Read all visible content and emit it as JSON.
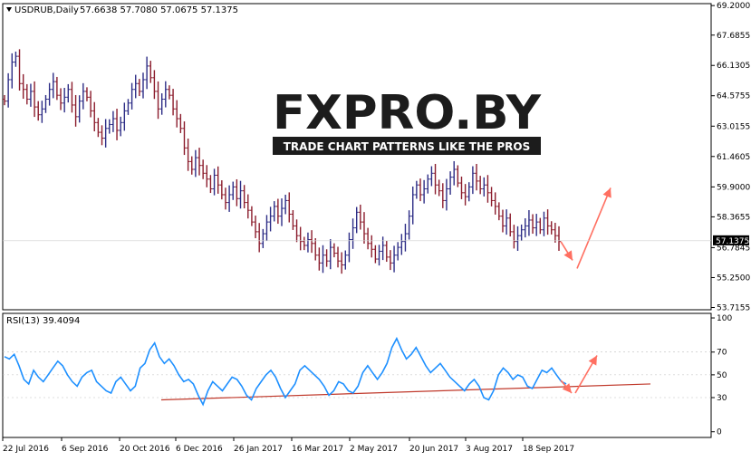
{
  "chart_data": [
    {
      "type": "ohlc",
      "header": {
        "symbol": "USDRUB,Daily",
        "ohlc_text": "57.6638 57.7080 57.0675 57.1375"
      },
      "x_tick_labels": [
        "22 Jul 2016",
        "6 Sep 2016",
        "20 Oct 2016",
        "6 Dec 2016",
        "26 Jan 2017",
        "16 Mar 2017",
        "2 May 2017",
        "20 Jun 2017",
        "3 Aug 2017",
        "18 Sep 2017"
      ],
      "y_ticks": [
        69.2,
        67.6855,
        66.1305,
        64.5755,
        63.0155,
        61.4605,
        59.9,
        58.3655,
        56.7845,
        55.25,
        53.7155
      ],
      "ylim": [
        53.6,
        69.3
      ],
      "current_price": 57.1375,
      "current_price_label": "57.1375",
      "close_series": [
        64.3,
        65.4,
        66.3,
        66.6,
        65.2,
        64.9,
        64.4,
        64.8,
        64.0,
        63.6,
        63.9,
        64.4,
        64.9,
        65.3,
        64.6,
        64.2,
        64.5,
        64.9,
        64.1,
        63.5,
        64.3,
        64.8,
        64.5,
        63.8,
        63.2,
        62.7,
        62.4,
        62.9,
        63.1,
        63.4,
        62.8,
        63.2,
        63.8,
        64.2,
        64.9,
        65.2,
        64.8,
        65.4,
        66.1,
        65.5,
        64.8,
        63.9,
        64.4,
        64.9,
        64.6,
        63.9,
        63.4,
        62.9,
        61.9,
        61.2,
        60.8,
        61.4,
        61.0,
        60.6,
        60.3,
        59.8,
        60.5,
        60.0,
        59.5,
        59.1,
        59.5,
        59.9,
        59.3,
        59.7,
        59.1,
        58.7,
        58.1,
        57.6,
        57.0,
        57.5,
        58.1,
        58.4,
        58.9,
        58.4,
        58.8,
        59.2,
        58.5,
        57.9,
        57.4,
        57.1,
        56.9,
        57.2,
        57.0,
        56.4,
        56.0,
        56.4,
        56.1,
        56.8,
        56.5,
        56.1,
        55.9,
        56.4,
        57.2,
        57.8,
        58.6,
        58.1,
        57.5,
        57.0,
        56.7,
        56.2,
        56.6,
        56.9,
        56.3,
        56.0,
        56.4,
        56.8,
        57.1,
        57.5,
        58.4,
        59.5,
        60.0,
        59.5,
        59.8,
        60.3,
        60.6,
        60.0,
        59.7,
        59.2,
        59.8,
        60.4,
        60.8,
        60.1,
        59.6,
        59.4,
        59.9,
        60.6,
        60.2,
        59.8,
        60.0,
        59.6,
        59.2,
        58.9,
        58.4,
        57.9,
        58.3,
        57.6,
        57.1,
        57.4,
        57.7,
        57.9,
        58.2,
        57.8,
        58.1,
        57.7,
        58.3,
        57.9,
        57.7,
        57.4,
        57.1
      ]
    },
    {
      "type": "line",
      "header": "RSI(13) 39.4094",
      "y_ticks": [
        100,
        70,
        50,
        30,
        0
      ],
      "ylim": [
        -5,
        104
      ],
      "values": [
        66,
        64,
        68,
        58,
        46,
        42,
        54,
        48,
        44,
        50,
        56,
        62,
        58,
        50,
        44,
        40,
        48,
        52,
        54,
        44,
        40,
        36,
        34,
        44,
        48,
        42,
        36,
        40,
        56,
        60,
        72,
        78,
        66,
        60,
        64,
        58,
        50,
        44,
        46,
        42,
        32,
        24,
        36,
        44,
        40,
        36,
        42,
        48,
        46,
        40,
        32,
        28,
        38,
        44,
        50,
        54,
        48,
        38,
        30,
        36,
        42,
        54,
        58,
        54,
        50,
        46,
        40,
        32,
        36,
        44,
        42,
        36,
        34,
        40,
        52,
        58,
        52,
        46,
        52,
        60,
        74,
        82,
        72,
        64,
        68,
        74,
        66,
        58,
        52,
        56,
        60,
        54,
        48,
        44,
        40,
        36,
        42,
        46,
        40,
        30,
        28,
        36,
        50,
        56,
        52,
        46,
        50,
        48,
        40,
        38,
        46,
        54,
        52,
        56,
        50,
        44,
        42
      ],
      "trendline": {
        "start": 28,
        "end": 42
      }
    }
  ],
  "logo": {
    "brand": "FXPRO.BY",
    "tagline": "TRADE CHART PATTERNS LIKE THE PROS"
  },
  "colors": {
    "up_bar": "#2d2d86",
    "down_bar": "#8b1c2c",
    "rsi_line": "#1e90ff",
    "trend_line": "#c0392b",
    "arrow": "#ff6f61",
    "axis": "#000000"
  }
}
